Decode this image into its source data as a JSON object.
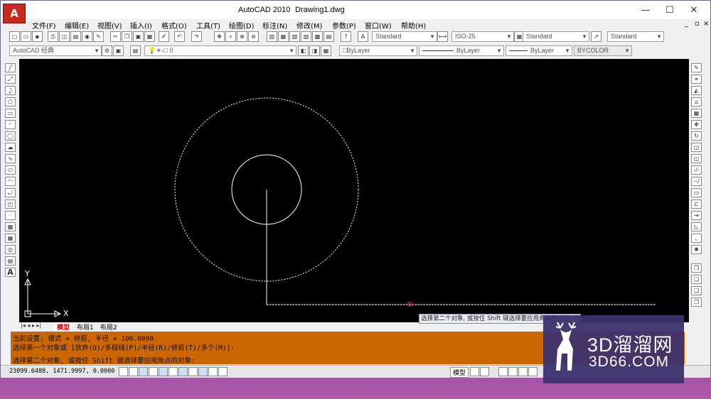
{
  "window": {
    "app_title": "AutoCAD 2010",
    "doc_title": "Drawing1.dwg",
    "minimize": "—",
    "maximize": "☐",
    "close": "✕"
  },
  "menu": [
    "文件(F)",
    "编辑(E)",
    "视图(V)",
    "插入(I)",
    "格式(O)",
    "工具(T)",
    "绘图(D)",
    "标注(N)",
    "修改(M)",
    "参数(P)",
    "窗口(W)",
    "帮助(H)"
  ],
  "mdi": {
    "minimize": "_",
    "restore": "▫",
    "close": "×"
  },
  "styles": {
    "text_style": "Standard",
    "dim_style": "ISO-25",
    "table_style": "Standard",
    "mleader_style": "Standard"
  },
  "workspace": "AutoCAD 经典",
  "layer": "0",
  "properties": {
    "color": "ByLayer",
    "linetype": "ByLayer",
    "lineweight": "ByLayer",
    "plotstyle": "BYCOLOR"
  },
  "tabs": [
    "模型",
    "布局1",
    "布局2"
  ],
  "ucs": {
    "x": "X",
    "y": "Y"
  },
  "command_lines": [
    "当前设置: 模式 = 修剪, 半径 = 100.0000",
    "选择第一个对象或 [放弃(U)/多段线(P)/半径(R)/修剪(T)/多个(M)]:",
    "选择第二个对象, 或按住 Shift 键选择要应用角点的对象:"
  ],
  "tooltip": "选择第二个对象, 或按住 Shift 键选择要应用角点的对象:",
  "status": {
    "coords": "23099.6488, 1471.9997, 0.0000",
    "model_label": "模型"
  },
  "watermark": {
    "big": "3D溜溜网",
    "small": "3D66.COM"
  },
  "colors": {
    "canvas": "#000000",
    "command_bg": "#cc6600",
    "app_button": "#c8281e"
  }
}
